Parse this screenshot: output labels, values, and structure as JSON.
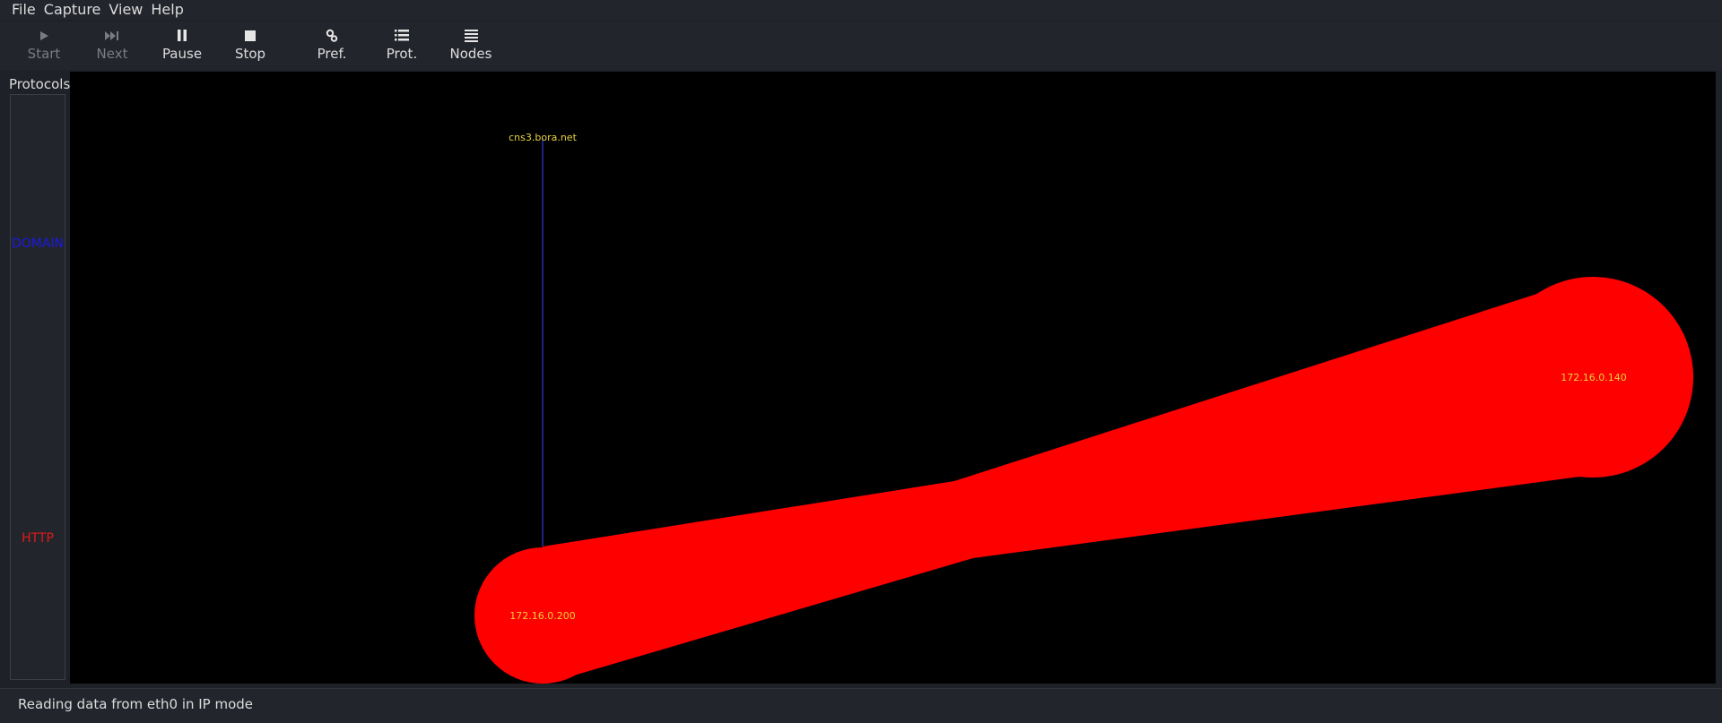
{
  "menubar": {
    "items": [
      "File",
      "Capture",
      "View",
      "Help"
    ]
  },
  "toolbar": {
    "start": {
      "label": "Start",
      "icon": "play-icon",
      "enabled": false
    },
    "next": {
      "label": "Next",
      "icon": "skip-forward-icon",
      "enabled": false
    },
    "pause": {
      "label": "Pause",
      "icon": "pause-icon",
      "enabled": true
    },
    "stop": {
      "label": "Stop",
      "icon": "stop-icon",
      "enabled": true
    },
    "pref": {
      "label": "Pref.",
      "icon": "gears-icon",
      "enabled": true
    },
    "prot": {
      "label": "Prot.",
      "icon": "list-icon",
      "enabled": true
    },
    "nodes": {
      "label": "Nodes",
      "icon": "menu-lines-icon",
      "enabled": true
    }
  },
  "protocols": {
    "title": "Protocols",
    "items": [
      {
        "name": "DOMAIN",
        "color": "#1a1ae0"
      },
      {
        "name": "HTTP",
        "color": "#e01a1a"
      }
    ]
  },
  "graph": {
    "background": "#000000",
    "node_label_color": "#e8d23a",
    "nodes": [
      {
        "label": "cns3.bora.net"
      },
      {
        "label": "172.16.0.140"
      },
      {
        "label": "172.16.0.200"
      }
    ],
    "links": [
      {
        "protocol": "DOMAIN",
        "color": "#2a2ab0"
      },
      {
        "protocol": "HTTP",
        "color": "#ff0000"
      }
    ]
  },
  "status": {
    "text": "Reading data from eth0 in IP mode"
  }
}
